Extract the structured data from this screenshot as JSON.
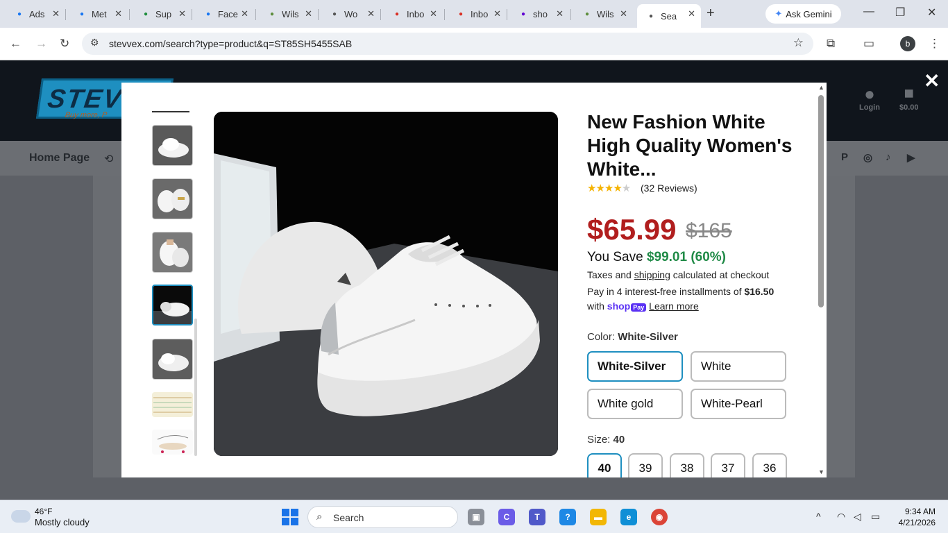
{
  "browser": {
    "tabs": [
      {
        "title": "Ads",
        "icon": "meta-icon",
        "color": "#1877f2"
      },
      {
        "title": "Met",
        "icon": "meta-icon",
        "color": "#1877f2"
      },
      {
        "title": "Sup",
        "icon": "sheet-icon",
        "color": "#1e8e3e"
      },
      {
        "title": "Face",
        "icon": "facebook-icon",
        "color": "#1877f2"
      },
      {
        "title": "Wils",
        "icon": "shopify-icon",
        "color": "#5e8e3e"
      },
      {
        "title": "Wo",
        "icon": "globe-icon",
        "color": "#555555"
      },
      {
        "title": "Inbo",
        "icon": "gmail-icon",
        "color": "#d93025"
      },
      {
        "title": "Inbo",
        "icon": "gmail-icon",
        "color": "#d93025"
      },
      {
        "title": "sho",
        "icon": "yahoo-icon",
        "color": "#6001d2"
      },
      {
        "title": "Wils",
        "icon": "shopify-icon",
        "color": "#5e8e3e"
      },
      {
        "title": "Sea",
        "icon": "globe-icon",
        "color": "#555555",
        "active": true
      }
    ],
    "ask_gemini": "Ask Gemini",
    "url": "stevvex.com/search?type=product&q=ST85SH5455SAB",
    "profile_initial": "b"
  },
  "site": {
    "logo_text": "STEVVEX",
    "logo_tagline": "Buy more, P",
    "login_label": "Login",
    "cart_total": "$0.00",
    "nav_home": "Home Page"
  },
  "product": {
    "title": "New Fashion White High Quality Women's White...",
    "rating": 4,
    "reviews": "(32 Reviews)",
    "price": "$65.99",
    "compare_price": "$165",
    "you_save_label": "You Save",
    "you_save_value": "$99.01 (60%)",
    "tax_pre": "Taxes and",
    "tax_link": "shipping",
    "tax_post": "calculated at checkout",
    "pay_text": "Pay in 4 interest-free installments of",
    "pay_amount": "$16.50",
    "pay_with": "with",
    "shop_pay": "shop",
    "shop_pay_badge": "Pay",
    "learn_more": "Learn more",
    "color_label": "Color:",
    "color_selected": "White-Silver",
    "colors": [
      "White-Silver",
      "White",
      "White gold",
      "White-Pearl"
    ],
    "size_label": "Size:",
    "size_selected": "40",
    "sizes": [
      "40",
      "39",
      "38",
      "37",
      "36"
    ]
  },
  "taskbar": {
    "temp": "46°F",
    "condition": "Mostly cloudy",
    "search_label": "Search",
    "time": "9:34 AM",
    "date": "4/21/2026"
  }
}
